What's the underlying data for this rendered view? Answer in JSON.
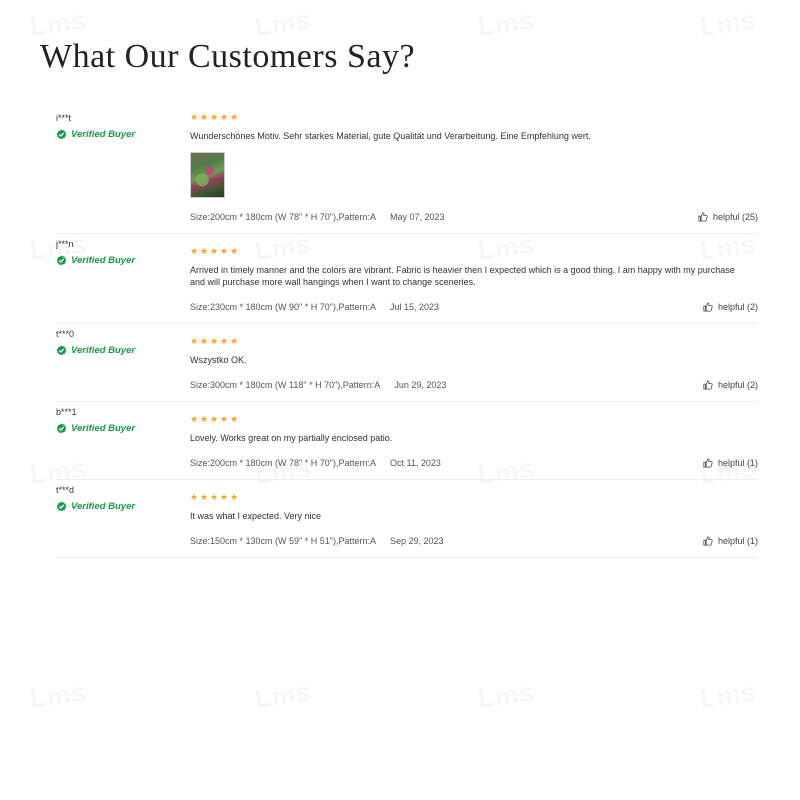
{
  "page_title": "What Our Customers Say?",
  "watermark_text": "Lms",
  "colors": {
    "star": "#f5a623",
    "verified": "#1a9a4a"
  },
  "verified_label": "Verified Buyer",
  "reviews": [
    {
      "user": "i***t",
      "rating": 5,
      "text": "Wunderschönes Motiv. Sehr starkes Material, gute Qualität und Verarbeitung. Eine Empfehlung wert.",
      "has_photo": true,
      "size": "Size:200cm * 180cm (W 78\" * H 70\"),Pattern:A",
      "date": "May 07, 2023",
      "helpful": "helpful (25)"
    },
    {
      "user": "j***n",
      "rating": 5,
      "text": "Arrived in timely manner and the colors are vibrant. Fabric is heavier then I expected which is a good thing. I am happy with my purchase and will purchase more wall hangings when I want to change sceneries.",
      "has_photo": false,
      "size": "Size:230cm * 180cm (W 90\" * H 70\"),Pattern:A",
      "date": "Jul 15, 2023",
      "helpful": "helpful (2)"
    },
    {
      "user": "t***0",
      "rating": 5,
      "text": "Wszystko OK.",
      "has_photo": false,
      "size": "Size:300cm * 180cm (W 118\" * H 70\"),Pattern:A",
      "date": "Jun 29, 2023",
      "helpful": "helpful (2)"
    },
    {
      "user": "b***1",
      "rating": 5,
      "text": "Lovely. Works great on my partially enclosed patio.",
      "has_photo": false,
      "size": "Size:200cm * 180cm (W 78\" * H 70\"),Pattern:A",
      "date": "Oct 11, 2023",
      "helpful": "helpful (1)"
    },
    {
      "user": "t***d",
      "rating": 5,
      "text": "It was what I expected. Very nice",
      "has_photo": false,
      "size": "Size:150cm * 130cm (W 59\" * H 51\"),Pattern:A",
      "date": "Sep 29, 2023",
      "helpful": "helpful (1)"
    }
  ]
}
